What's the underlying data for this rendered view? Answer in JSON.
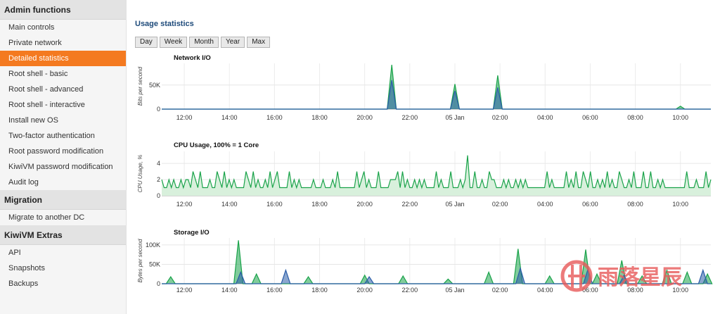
{
  "sidebar": {
    "sections": [
      {
        "title": "Admin functions",
        "items": [
          {
            "label": "Main controls"
          },
          {
            "label": "Private network"
          },
          {
            "label": "Detailed statistics",
            "active": true
          },
          {
            "label": "Root shell - basic"
          },
          {
            "label": "Root shell - advanced"
          },
          {
            "label": "Root shell - interactive"
          },
          {
            "label": "Install new OS"
          },
          {
            "label": "Two-factor authentication"
          },
          {
            "label": "Root password modification"
          },
          {
            "label": "KiwiVM password modification"
          },
          {
            "label": "Audit log"
          }
        ]
      },
      {
        "title": "Migration",
        "items": [
          {
            "label": "Migrate to another DC"
          }
        ]
      },
      {
        "title": "KiwiVM Extras",
        "items": [
          {
            "label": "API"
          },
          {
            "label": "Snapshots"
          },
          {
            "label": "Backups"
          }
        ]
      }
    ]
  },
  "main": {
    "title": "Usage statistics",
    "range_buttons": [
      "Day",
      "Week",
      "Month",
      "Year",
      "Max"
    ]
  },
  "watermark": {
    "text": "雨落星辰"
  },
  "colors": {
    "accent": "#f47a20",
    "green": "#1aa34a",
    "blue": "#2a5ca8",
    "fill": "#d8f0dc"
  },
  "chart_data": [
    {
      "type": "area",
      "title": "Network I/O",
      "ylabel": "Bits per second",
      "yticks": [
        {
          "v": 0,
          "label": "0"
        },
        {
          "v": 50000,
          "label": "50K"
        }
      ],
      "ylim": [
        0,
        95000
      ],
      "x_ticks": [
        "12:00",
        "14:00",
        "16:00",
        "18:00",
        "20:00",
        "22:00",
        "05 Jan",
        "02:00",
        "04:00",
        "06:00",
        "08:00",
        "10:00"
      ],
      "series": [
        {
          "color": "green",
          "points": [
            [
              21.0,
              0
            ],
            [
              21.2,
              92000
            ],
            [
              21.4,
              0
            ],
            [
              23.8,
              0
            ],
            [
              24.0,
              52000
            ],
            [
              24.2,
              0
            ],
            [
              25.7,
              0
            ],
            [
              25.9,
              70000
            ],
            [
              26.1,
              0
            ],
            [
              33.8,
              0
            ],
            [
              34.0,
              6000
            ],
            [
              34.2,
              0
            ]
          ]
        },
        {
          "color": "blue",
          "points": [
            [
              21.0,
              0
            ],
            [
              21.2,
              60000
            ],
            [
              21.4,
              0
            ],
            [
              23.8,
              0
            ],
            [
              24.0,
              38000
            ],
            [
              24.2,
              0
            ],
            [
              25.7,
              0
            ],
            [
              25.9,
              45000
            ],
            [
              26.1,
              0
            ]
          ]
        }
      ]
    },
    {
      "type": "area",
      "title": "CPU Usage, 100% = 1 Core",
      "ylabel": "CPU Usage, %",
      "yticks": [
        {
          "v": 0,
          "label": "0"
        },
        {
          "v": 2,
          "label": "2"
        },
        {
          "v": 4,
          "label": "4"
        }
      ],
      "ylim": [
        0,
        5.5
      ],
      "x_ticks": [
        "12:00",
        "14:00",
        "16:00",
        "18:00",
        "20:00",
        "22:00",
        "05 Jan",
        "02:00",
        "04:00",
        "06:00",
        "08:00",
        "10:00"
      ],
      "series": [
        {
          "color": "green",
          "filled": true,
          "values": [
            2,
            1,
            1,
            2,
            1,
            2,
            1,
            1,
            2,
            1,
            2,
            2,
            1,
            3,
            2,
            1,
            3,
            1,
            1,
            1,
            2,
            1,
            1,
            3,
            2,
            1,
            3,
            1,
            2,
            1,
            2,
            1,
            1,
            1,
            1,
            3,
            2,
            1,
            3,
            1,
            2,
            1,
            1,
            2,
            1,
            3,
            1,
            2,
            3,
            1,
            1,
            1,
            1,
            3,
            1,
            2,
            1,
            2,
            1,
            1,
            1,
            1,
            1,
            2,
            1,
            1,
            1,
            2,
            1,
            1,
            1,
            2,
            1,
            3,
            1,
            1,
            1,
            1,
            1,
            1,
            1,
            3,
            1,
            2,
            3,
            1,
            2,
            1,
            1,
            1,
            3,
            1,
            1,
            1,
            1,
            2,
            2,
            2,
            3,
            1,
            3,
            1,
            2,
            1,
            1,
            2,
            1,
            2,
            1,
            2,
            1,
            1,
            1,
            1,
            3,
            1,
            2,
            1,
            1,
            1,
            3,
            1,
            1,
            1,
            2,
            1,
            2,
            5,
            1,
            1,
            3,
            1,
            1,
            2,
            1,
            1,
            3,
            2,
            2,
            1,
            1,
            1,
            2,
            1,
            2,
            1,
            1,
            2,
            1,
            2,
            1,
            2,
            1,
            1,
            1,
            1,
            1,
            1,
            1,
            1,
            3,
            1,
            2,
            1,
            1,
            1,
            1,
            1,
            3,
            1,
            2,
            1,
            3,
            1,
            1,
            3,
            2,
            1,
            3,
            1,
            1,
            2,
            1,
            2,
            1,
            3,
            1,
            2,
            1,
            1,
            3,
            2,
            1,
            1,
            2,
            1,
            3,
            1,
            1,
            1,
            3,
            1,
            1,
            3,
            1,
            1,
            2,
            1,
            2,
            1,
            1,
            1,
            1,
            1,
            1,
            1,
            1,
            1,
            3,
            1,
            1,
            1,
            2,
            1,
            1,
            1,
            3,
            1,
            2
          ]
        }
      ]
    },
    {
      "type": "area",
      "title": "Storage I/O",
      "ylabel": "Bytes per second",
      "yticks": [
        {
          "v": 0,
          "label": "0"
        },
        {
          "v": 50000,
          "label": "50K"
        },
        {
          "v": 100000,
          "label": "100K"
        }
      ],
      "ylim": [
        0,
        118000
      ],
      "x_ticks": [
        "12:00",
        "14:00",
        "16:00",
        "18:00",
        "20:00",
        "22:00",
        "05 Jan",
        "02:00",
        "04:00",
        "06:00",
        "08:00",
        "10:00"
      ],
      "series": [
        {
          "color": "green",
          "points": [
            [
              11.2,
              0
            ],
            [
              11.4,
              18000
            ],
            [
              11.6,
              0
            ],
            [
              14.2,
              0
            ],
            [
              14.4,
              112000
            ],
            [
              14.6,
              0
            ],
            [
              15.0,
              0
            ],
            [
              15.2,
              25000
            ],
            [
              15.4,
              0
            ],
            [
              17.3,
              0
            ],
            [
              17.5,
              18000
            ],
            [
              17.7,
              0
            ],
            [
              19.8,
              0
            ],
            [
              20.0,
              22000
            ],
            [
              20.2,
              0
            ],
            [
              21.5,
              0
            ],
            [
              21.7,
              20000
            ],
            [
              21.9,
              0
            ],
            [
              23.5,
              0
            ],
            [
              23.7,
              12000
            ],
            [
              23.9,
              0
            ],
            [
              25.3,
              0
            ],
            [
              25.5,
              30000
            ],
            [
              25.7,
              0
            ],
            [
              26.6,
              0
            ],
            [
              26.8,
              90000
            ],
            [
              27.0,
              0
            ],
            [
              28.0,
              0
            ],
            [
              28.2,
              20000
            ],
            [
              28.4,
              0
            ],
            [
              29.6,
              0
            ],
            [
              29.8,
              88000
            ],
            [
              30.0,
              0
            ],
            [
              30.1,
              0
            ],
            [
              30.3,
              25000
            ],
            [
              30.5,
              0
            ],
            [
              31.2,
              0
            ],
            [
              31.4,
              60000
            ],
            [
              31.6,
              0
            ],
            [
              32.1,
              0
            ],
            [
              32.3,
              20000
            ],
            [
              32.5,
              0
            ],
            [
              33.2,
              0
            ],
            [
              33.4,
              35000
            ],
            [
              33.6,
              0
            ],
            [
              34.1,
              0
            ],
            [
              34.3,
              30000
            ],
            [
              34.5,
              0
            ],
            [
              35.0,
              0
            ],
            [
              35.2,
              25000
            ],
            [
              35.4,
              0
            ]
          ]
        },
        {
          "color": "blue",
          "points": [
            [
              14.3,
              0
            ],
            [
              14.5,
              30000
            ],
            [
              14.7,
              0
            ],
            [
              16.3,
              0
            ],
            [
              16.5,
              35000
            ],
            [
              16.7,
              0
            ],
            [
              20.0,
              0
            ],
            [
              20.2,
              18000
            ],
            [
              20.4,
              0
            ],
            [
              26.7,
              0
            ],
            [
              26.9,
              40000
            ],
            [
              27.1,
              0
            ],
            [
              29.7,
              0
            ],
            [
              29.9,
              38000
            ],
            [
              30.1,
              0
            ],
            [
              31.3,
              0
            ],
            [
              31.5,
              22000
            ],
            [
              31.7,
              0
            ],
            [
              34.8,
              0
            ],
            [
              35.0,
              35000
            ],
            [
              35.2,
              0
            ]
          ]
        }
      ]
    }
  ]
}
